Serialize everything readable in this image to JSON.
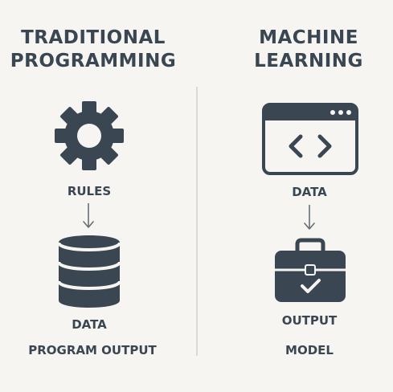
{
  "left": {
    "title_line1": "TRADITIONAL",
    "title_line2": "PROGRAMMING",
    "icon_top": "gear-icon",
    "label_top": "RULES",
    "icon_bottom": "database-icon",
    "label_data": "DATA",
    "label_output": "PROGRAM OUTPUT"
  },
  "right": {
    "title_line1": "MACHINE",
    "title_line2": "LEARNING",
    "icon_top": "code-window-icon",
    "label_top": "DATA",
    "icon_bottom": "briefcase-check-icon",
    "label_output": "OUTPUT",
    "label_model": "MODEL"
  },
  "colors": {
    "background": "#f7f5f2",
    "icon": "#3a4652",
    "arrow": "#666e78",
    "divider": "#dcd9d4"
  }
}
